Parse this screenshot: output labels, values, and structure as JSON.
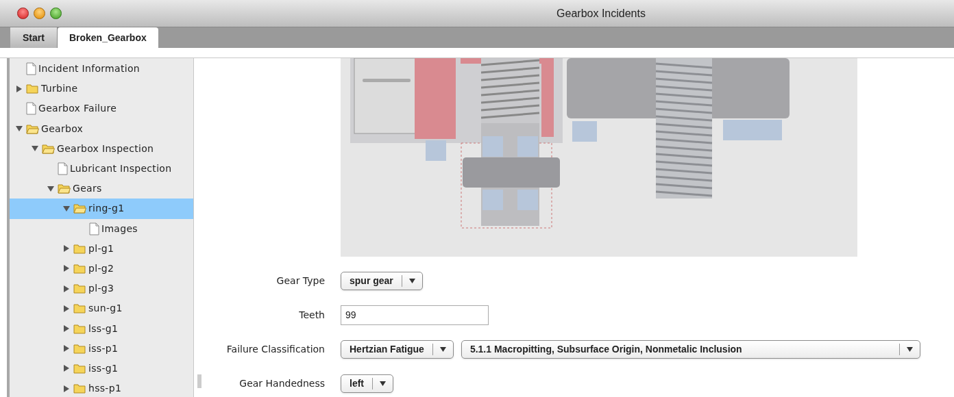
{
  "window": {
    "title": "Gearbox Incidents"
  },
  "tabs": [
    {
      "label": "Start",
      "selected": false
    },
    {
      "label": "Broken_Gearbox",
      "selected": true
    }
  ],
  "tree": [
    {
      "kind": "file",
      "label": "Incident Information",
      "selected": false
    },
    {
      "kind": "folder",
      "label": "Turbine",
      "expanded": false,
      "selected": false
    },
    {
      "kind": "file",
      "label": "Gearbox Failure",
      "selected": false
    },
    {
      "kind": "folder",
      "label": "Gearbox",
      "expanded": true,
      "selected": false,
      "children": [
        {
          "kind": "folder",
          "label": "Gearbox Inspection",
          "expanded": true,
          "selected": false,
          "children": [
            {
              "kind": "file",
              "label": "Lubricant Inspection",
              "selected": false
            },
            {
              "kind": "folder",
              "label": "Gears",
              "expanded": true,
              "selected": false,
              "children": [
                {
                  "kind": "folder",
                  "label": "ring-g1",
                  "expanded": true,
                  "selected": true,
                  "children": [
                    {
                      "kind": "file",
                      "label": "Images",
                      "selected": false
                    }
                  ]
                },
                {
                  "kind": "folder",
                  "label": "pl-g1",
                  "expanded": false,
                  "selected": false
                },
                {
                  "kind": "folder",
                  "label": "pl-g2",
                  "expanded": false,
                  "selected": false
                },
                {
                  "kind": "folder",
                  "label": "pl-g3",
                  "expanded": false,
                  "selected": false
                },
                {
                  "kind": "folder",
                  "label": "sun-g1",
                  "expanded": false,
                  "selected": false
                },
                {
                  "kind": "folder",
                  "label": "lss-g1",
                  "expanded": false,
                  "selected": false
                },
                {
                  "kind": "folder",
                  "label": "iss-p1",
                  "expanded": false,
                  "selected": false
                },
                {
                  "kind": "folder",
                  "label": "iss-g1",
                  "expanded": false,
                  "selected": false
                },
                {
                  "kind": "folder",
                  "label": "hss-p1",
                  "expanded": false,
                  "selected": false
                }
              ]
            }
          ]
        }
      ]
    }
  ],
  "form": [
    {
      "kind": "select",
      "label": "Gear Type",
      "values": [
        "spur gear"
      ]
    },
    {
      "kind": "text",
      "label": "Teeth",
      "value": "99"
    },
    {
      "kind": "select",
      "label": "Failure Classification",
      "values": [
        "Hertzian Fatigue",
        "5.1.1 Macropitting, Subsurface Origin, Nonmetalic Inclusion"
      ]
    },
    {
      "kind": "select",
      "label": "Gear Handedness",
      "values": [
        "left"
      ]
    }
  ]
}
